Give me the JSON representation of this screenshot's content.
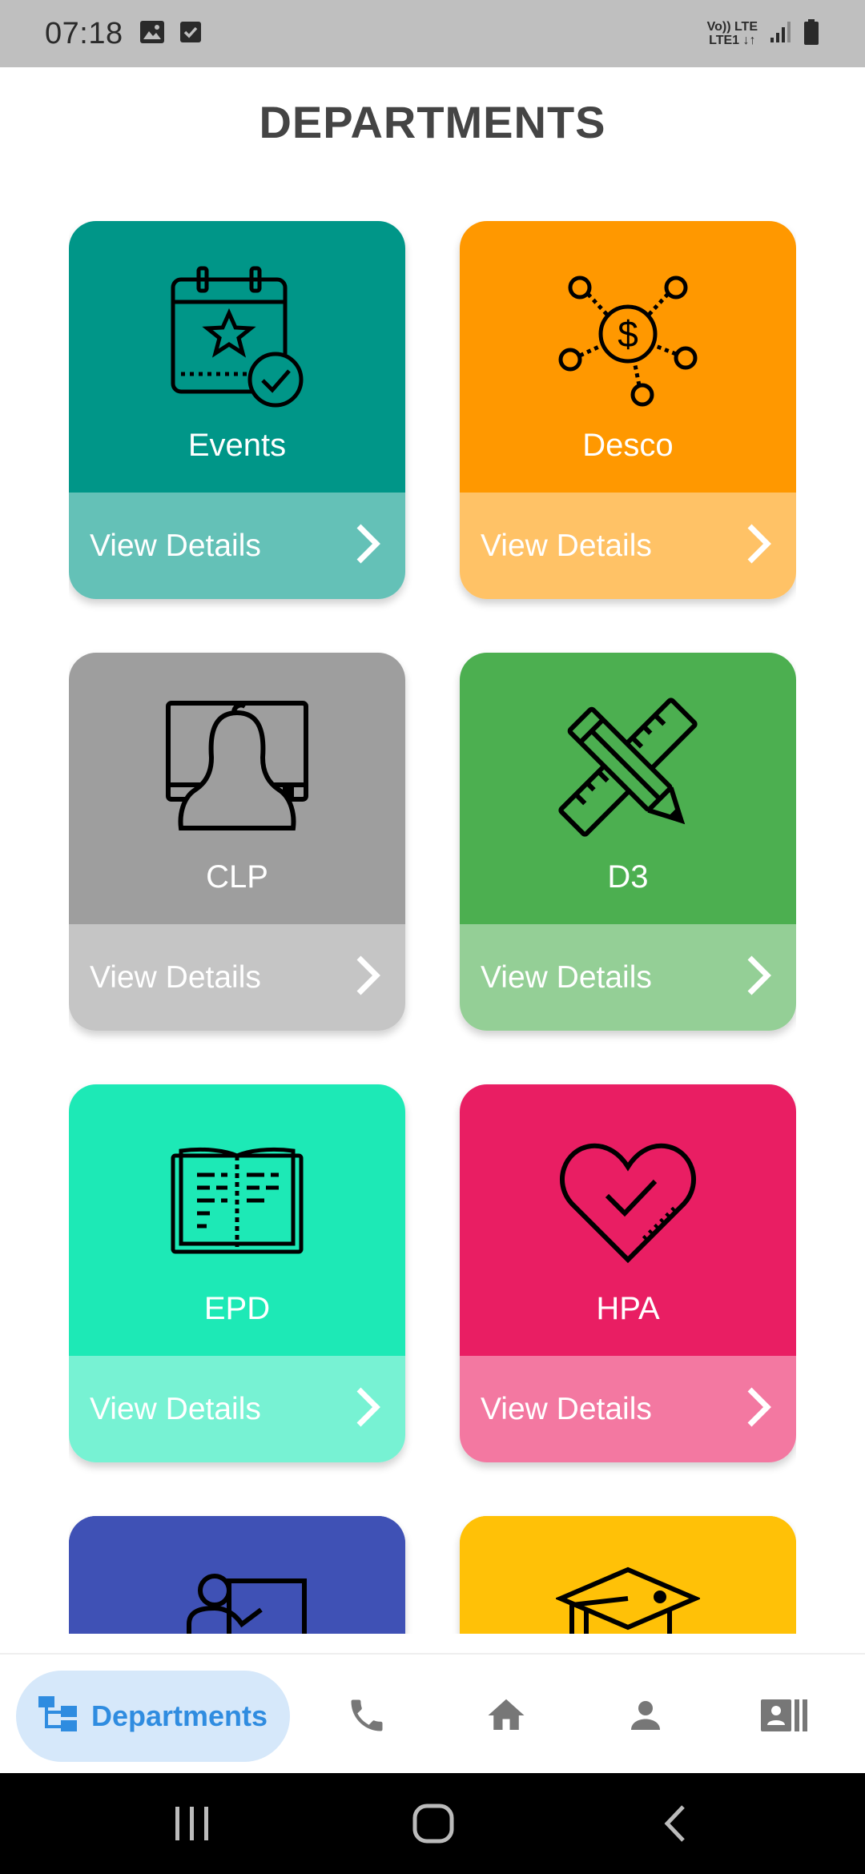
{
  "status_bar": {
    "time": "07:18",
    "network_line1": "Vo)) LTE",
    "network_line2": "LTE1 ↓↑",
    "icons": [
      "image-icon",
      "checkbox-icon",
      "signal-icon",
      "battery-icon"
    ]
  },
  "page": {
    "title": "DEPARTMENTS"
  },
  "departments": [
    {
      "name": "Events",
      "action": "View Details",
      "icon": "calendar-star-icon",
      "color_top": "#009688",
      "color_bottom": "#64c1b7"
    },
    {
      "name": "Desco",
      "action": "View Details",
      "icon": "money-network-icon",
      "color_top": "#ff9800",
      "color_bottom": "#ffc266"
    },
    {
      "name": "CLP",
      "action": "View Details",
      "icon": "monitor-person-icon",
      "color_top": "#9e9e9e",
      "color_bottom": "#c5c5c5"
    },
    {
      "name": "D3",
      "action": "View Details",
      "icon": "pencil-ruler-icon",
      "color_top": "#4caf50",
      "color_bottom": "#94cf96"
    },
    {
      "name": "EPD",
      "action": "View Details",
      "icon": "open-book-icon",
      "color_top": "#1de9b6",
      "color_bottom": "#77f2d3"
    },
    {
      "name": "HPA",
      "action": "View Details",
      "icon": "heart-check-icon",
      "color_top": "#e91e63",
      "color_bottom": "#f378a1"
    },
    {
      "name": "",
      "action": "",
      "icon": "teacher-board-icon",
      "color_top": "#3f51b5",
      "color_bottom": "#3f51b5"
    },
    {
      "name": "",
      "action": "",
      "icon": "graduation-cap-icon",
      "color_top": "#ffc107",
      "color_bottom": "#ffc107"
    }
  ],
  "bottom_nav": {
    "active_label": "Departments",
    "active_color": "#2f8ce0",
    "items": [
      "departments-icon",
      "phone-icon",
      "home-icon",
      "person-icon",
      "contact-card-icon"
    ]
  },
  "system_nav": {
    "items": [
      "recents-icon",
      "home-circle-icon",
      "back-icon"
    ]
  }
}
